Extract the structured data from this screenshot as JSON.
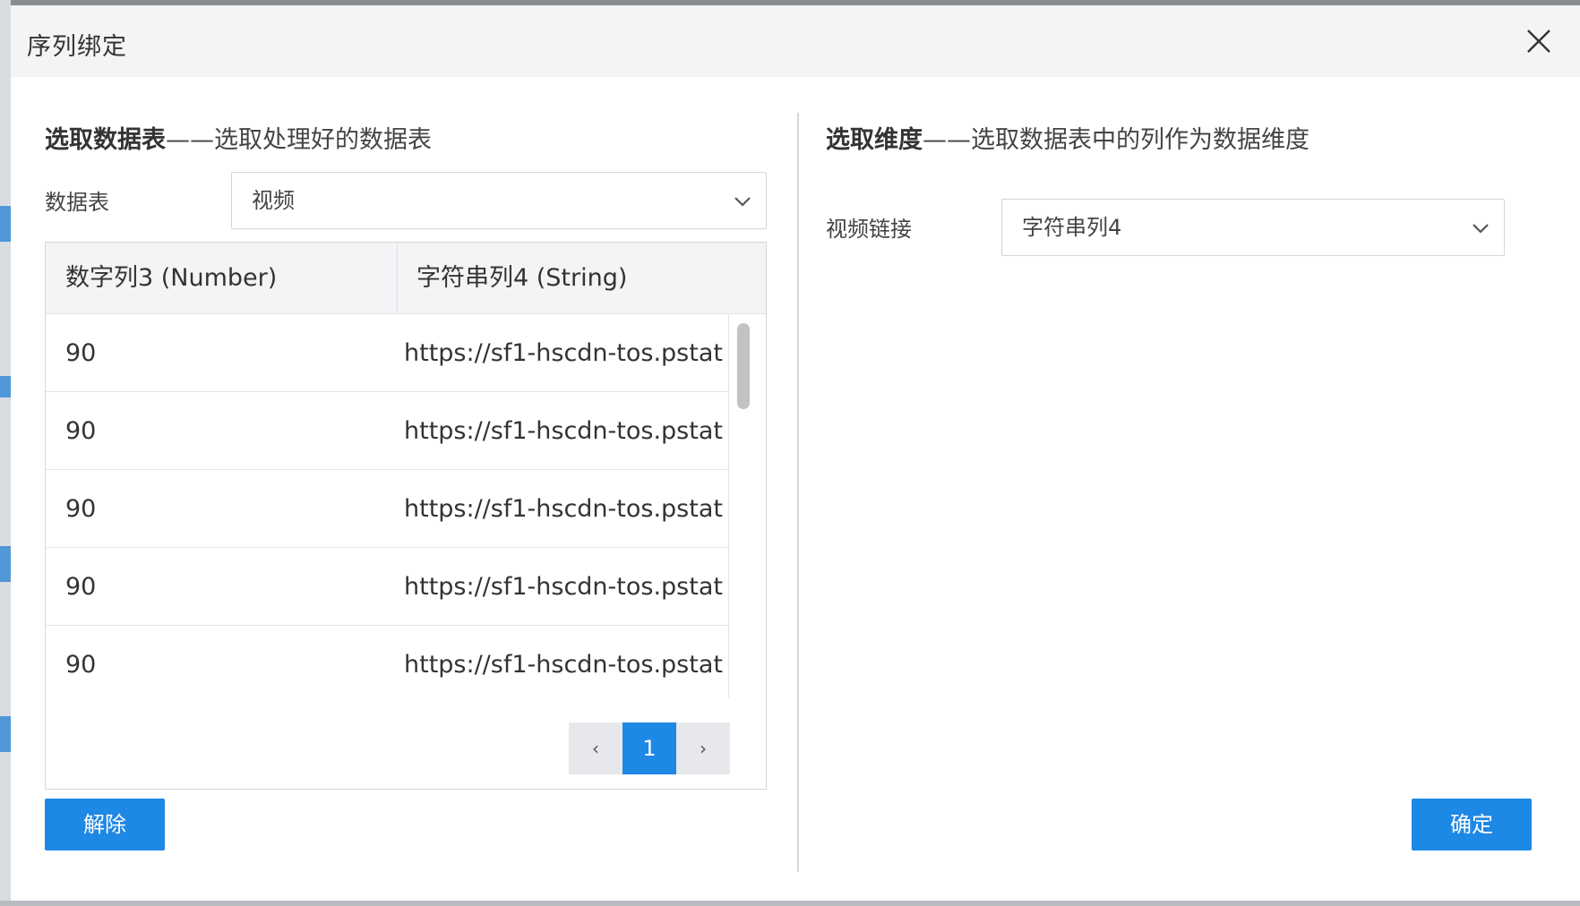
{
  "dialog": {
    "title": "序列绑定"
  },
  "left": {
    "heading_bold": "选取数据表",
    "heading_rest": "——选取处理好的数据表",
    "table_label": "数据表",
    "table_select_value": "视频",
    "columns": [
      "数字列3 (Number)",
      "字符串列4 (String)"
    ],
    "rows": [
      [
        "90",
        "https://sf1-hscdn-tos.pstatp."
      ],
      [
        "90",
        "https://sf1-hscdn-tos.pstatp."
      ],
      [
        "90",
        "https://sf1-hscdn-tos.pstatp."
      ],
      [
        "90",
        "https://sf1-hscdn-tos.pstatp."
      ],
      [
        "90",
        "https://sf1-hscdn-tos.pstatp."
      ]
    ],
    "pagination": {
      "prev": "‹",
      "current": "1",
      "next": "›"
    },
    "unbind_button": "解除"
  },
  "right": {
    "heading_bold": "选取维度",
    "heading_rest": "——选取数据表中的列作为数据维度",
    "dimension_label": "视频链接",
    "dimension_select_value": "字符串列4",
    "confirm_button": "确定"
  },
  "colors": {
    "primary": "#1e88e5",
    "header_bg": "#f3f4f6"
  }
}
